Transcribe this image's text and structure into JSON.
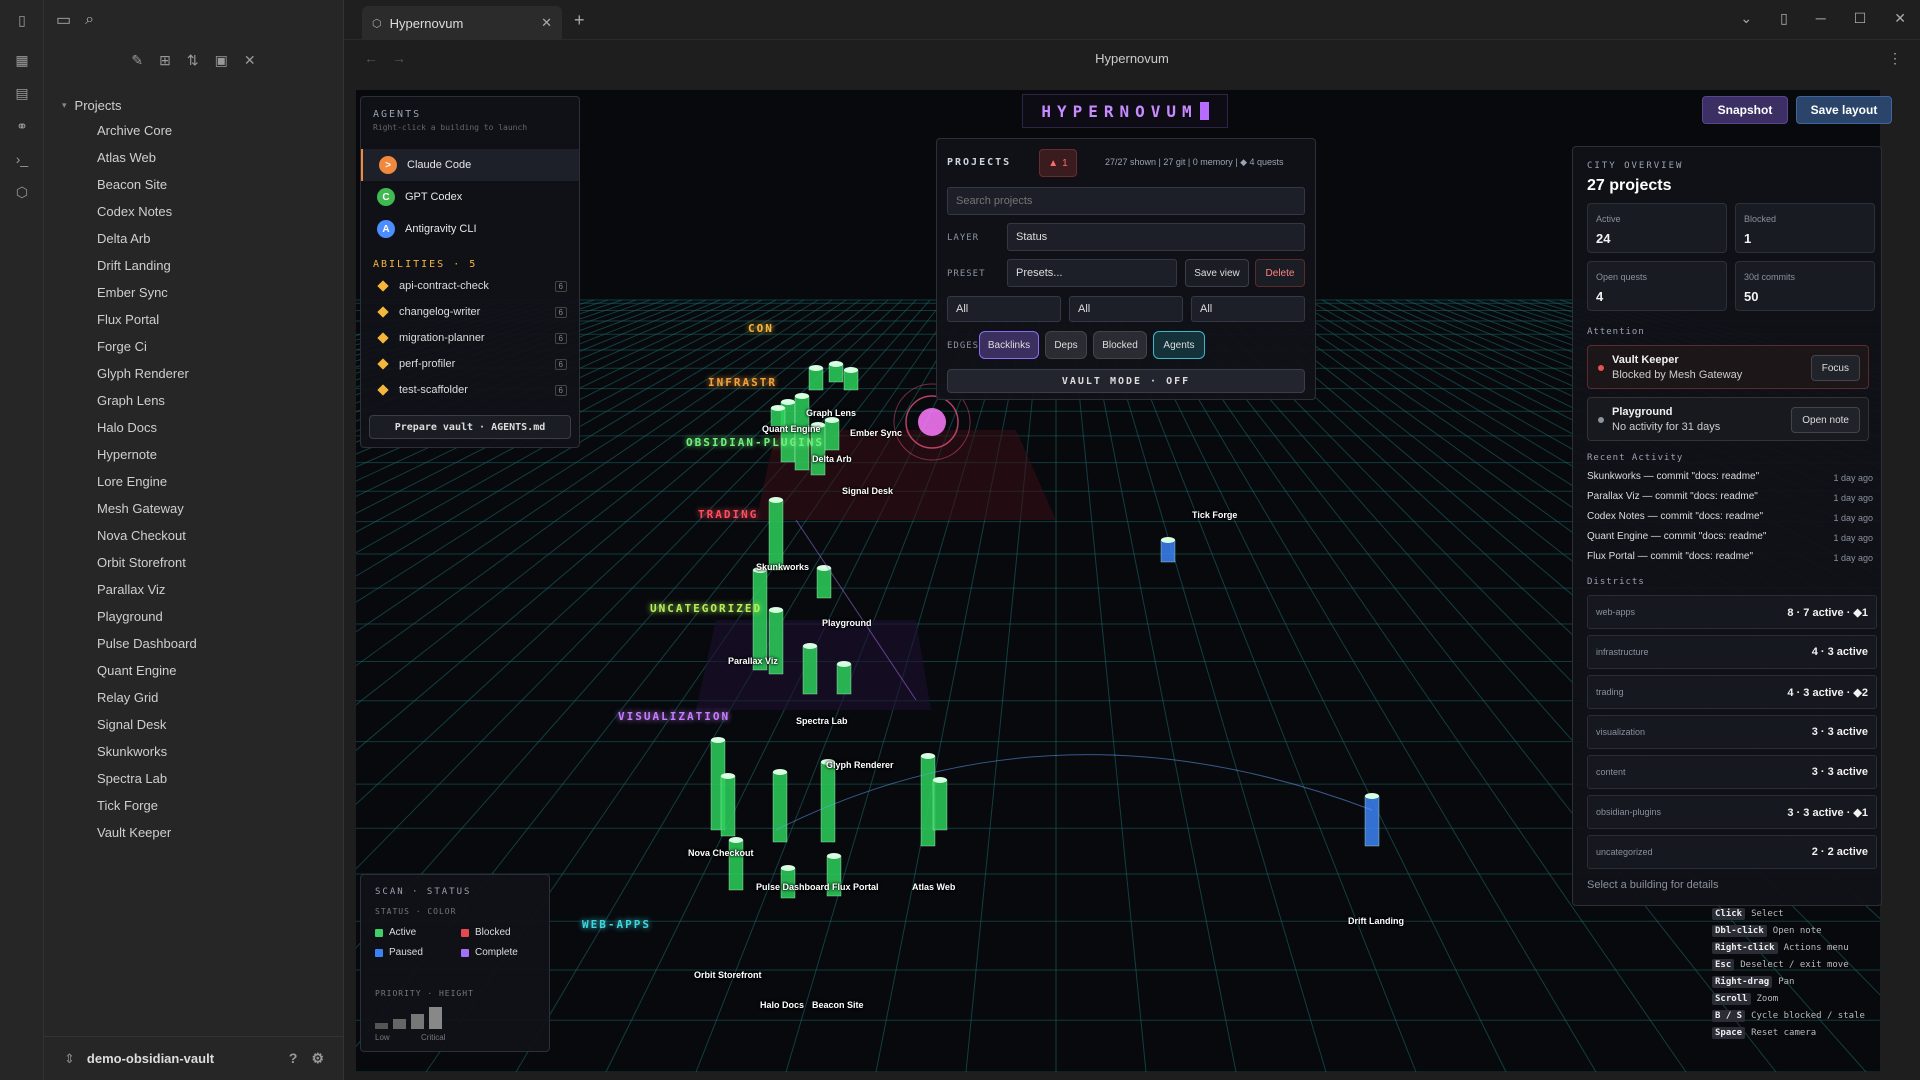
{
  "app": {
    "title": "Hypernovum",
    "tab_title": "Hypernovum"
  },
  "sidebar": {
    "section": "Projects",
    "items": [
      "Archive Core",
      "Atlas Web",
      "Beacon Site",
      "Codex Notes",
      "Delta Arb",
      "Drift Landing",
      "Ember Sync",
      "Flux Portal",
      "Forge Ci",
      "Glyph Renderer",
      "Graph Lens",
      "Halo Docs",
      "Hypernote",
      "Lore Engine",
      "Mesh Gateway",
      "Nova Checkout",
      "Orbit Storefront",
      "Parallax Viz",
      "Playground",
      "Pulse Dashboard",
      "Quant Engine",
      "Relay Grid",
      "Signal Desk",
      "Skunkworks",
      "Spectra Lab",
      "Tick Forge",
      "Vault Keeper"
    ],
    "vault_name": "demo-obsidian-vault"
  },
  "agents_panel": {
    "title": "AGENTS",
    "subtitle": "Right-click a building to launch",
    "agents": [
      {
        "name": "Claude Code",
        "glyph": ">",
        "color": "#f0883e"
      },
      {
        "name": "GPT Codex",
        "glyph": "C",
        "color": "#3fb950"
      },
      {
        "name": "Antigravity CLI",
        "glyph": "A",
        "color": "#4c8dff"
      }
    ],
    "abilities_title": "ABILITIES · 5",
    "abilities": [
      {
        "name": "api-contract-check",
        "count": "6"
      },
      {
        "name": "changelog-writer",
        "count": "6"
      },
      {
        "name": "migration-planner",
        "count": "6"
      },
      {
        "name": "perf-profiler",
        "count": "6"
      },
      {
        "name": "test-scaffolder",
        "count": "6"
      }
    ],
    "prepare_label": "Prepare vault · AGENTS.md"
  },
  "logo": "HYPERNOVUM",
  "toolbar": {
    "snapshot": "Snapshot",
    "save_layout": "Save layout"
  },
  "projects_panel": {
    "title": "PROJECTS",
    "alert_count": "1",
    "summary": "27/27 shown | 27 git | 0 memory | ◆ 4 quests",
    "search_placeholder": "Search projects",
    "layer_label": "LAYER",
    "layer_value": "Status",
    "preset_label": "PRESET",
    "preset_value": "Presets...",
    "save_view": "Save view",
    "delete": "Delete",
    "filters": [
      "All",
      "All",
      "All"
    ],
    "edges_label": "EDGES",
    "edges": [
      "Backlinks",
      "Deps",
      "Blocked",
      "Agents"
    ],
    "vault_mode": "VAULT MODE · OFF"
  },
  "city_overview": {
    "section": "CITY OVERVIEW",
    "title": "27 projects",
    "stats": [
      {
        "label": "Active",
        "value": "24"
      },
      {
        "label": "Blocked",
        "value": "1"
      },
      {
        "label": "Open quests",
        "value": "4"
      },
      {
        "label": "30d commits",
        "value": "50"
      }
    ],
    "attention_title": "Attention",
    "attention": [
      {
        "name": "Vault Keeper",
        "detail": "Blocked by Mesh Gateway",
        "action": "Focus",
        "color": "#e5534b"
      },
      {
        "name": "Playground",
        "detail": "No activity for 31 days",
        "action": "Open note",
        "color": "#8b949e"
      }
    ],
    "activity_title": "Recent Activity",
    "activity": [
      {
        "text": "Skunkworks — commit \"docs: readme\"",
        "time": "1 day ago"
      },
      {
        "text": "Parallax Viz — commit \"docs: readme\"",
        "time": "1 day ago"
      },
      {
        "text": "Codex Notes — commit \"docs: readme\"",
        "time": "1 day ago"
      },
      {
        "text": "Quant Engine — commit \"docs: readme\"",
        "time": "1 day ago"
      },
      {
        "text": "Flux Portal — commit \"docs: readme\"",
        "time": "1 day ago"
      }
    ],
    "districts_title": "Districts",
    "districts": [
      {
        "name": "web-apps",
        "stat": "8 · 7 active · ◆1"
      },
      {
        "name": "infrastructure",
        "stat": "4 · 3 active"
      },
      {
        "name": "trading",
        "stat": "4 · 3 active · ◆2"
      },
      {
        "name": "visualization",
        "stat": "3 · 3 active"
      },
      {
        "name": "content",
        "stat": "3 · 3 active"
      },
      {
        "name": "obsidian-plugins",
        "stat": "3 · 3 active · ◆1"
      },
      {
        "name": "uncategorized",
        "stat": "2 · 2 active"
      }
    ],
    "hint": "Select a building for details"
  },
  "legend": {
    "title": "SCAN · STATUS",
    "status_title": "STATUS · COLOR",
    "statuses": [
      {
        "name": "Active",
        "color": "#3fd06a"
      },
      {
        "name": "Blocked",
        "color": "#e5484d"
      },
      {
        "name": "Paused",
        "color": "#3b82f6"
      },
      {
        "name": "Complete",
        "color": "#a371f7"
      }
    ],
    "priority_title": "PRIORITY · HEIGHT",
    "low": "Low",
    "critical": "Critical"
  },
  "keys": [
    {
      "key": "Click",
      "action": "Select"
    },
    {
      "key": "Dbl-click",
      "action": "Open note"
    },
    {
      "key": "Right-click",
      "action": "Actions menu"
    },
    {
      "key": "Esc",
      "action": "Deselect / exit move"
    },
    {
      "key": "Right-drag",
      "action": "Pan"
    },
    {
      "key": "Scroll",
      "action": "Zoom"
    },
    {
      "key": "B / S",
      "action": "Cycle blocked / stale"
    },
    {
      "key": "Space",
      "action": "Reset camera"
    }
  ],
  "districts_map": [
    {
      "name": "CON",
      "color": "#f5b73b"
    },
    {
      "name": "INFRASTR",
      "color": "#f5a13b"
    },
    {
      "name": "OBSIDIAN-PLUGINS",
      "color": "#6ff07a"
    },
    {
      "name": "TRADING",
      "color": "#ff4d5e"
    },
    {
      "name": "UNCATEGORIZED",
      "color": "#b5f05a"
    },
    {
      "name": "VISUALIZATION",
      "color": "#c77dff"
    },
    {
      "name": "WEB-APPS",
      "color": "#3fd6e0"
    }
  ],
  "buildings": [
    "Graph Lens",
    "Quant Engine",
    "Ember Sync",
    "Delta Arb",
    "Signal Desk",
    "Tick Forge",
    "Skunkworks",
    "Playground",
    "Parallax Viz",
    "Spectra Lab",
    "Glyph Renderer",
    "Nova Checkout",
    "Pulse Dashboard",
    "Flux Portal",
    "Atlas Web",
    "Drift Landing",
    "Orbit Storefront",
    "Halo Docs",
    "Beacon Site"
  ]
}
